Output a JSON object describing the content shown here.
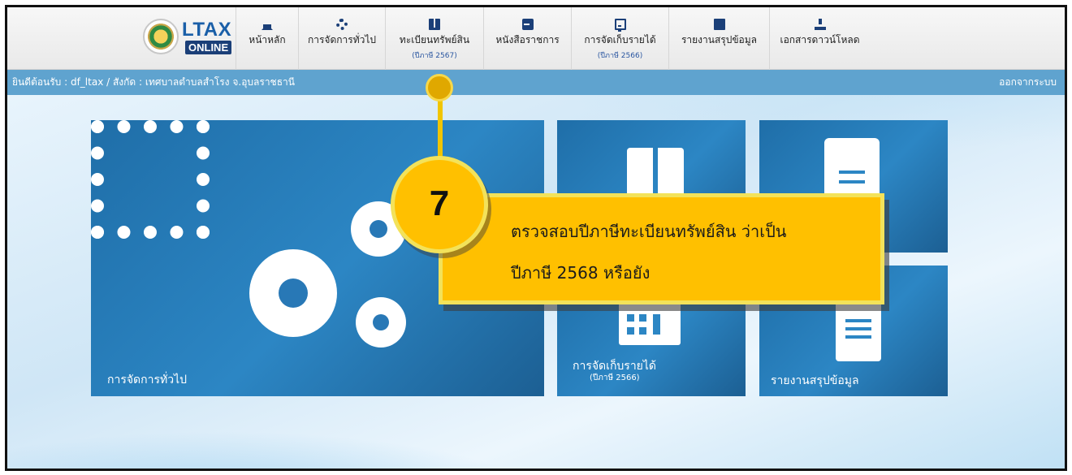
{
  "brand": {
    "title": "LTAX",
    "subtitle": "ONLINE"
  },
  "nav": [
    {
      "label": "หน้าหลัก",
      "icon": "home-icon",
      "sub": ""
    },
    {
      "label": "การจัดการทั่วไป",
      "icon": "gears-icon",
      "sub": ""
    },
    {
      "label": "ทะเบียนทรัพย์สิน",
      "icon": "book-icon",
      "sub": "(ปีภาษี 2567)"
    },
    {
      "label": "หนังสือราชการ",
      "icon": "document-icon",
      "sub": ""
    },
    {
      "label": "การจัดเก็บรายได้",
      "icon": "calculator-icon",
      "sub": "(ปีภาษี 2566)"
    },
    {
      "label": "รายงานสรุปข้อมูล",
      "icon": "report-icon",
      "sub": ""
    },
    {
      "label": "เอกสารดาวน์โหลด",
      "icon": "download-icon",
      "sub": ""
    }
  ],
  "welcome": {
    "text": "ยินดีต้อนรับ : df_ltax / สังกัด : เทศบาลตำบลสำโรง จ.อุบลราชธานี",
    "logout": "ออกจากระบบ"
  },
  "tiles": {
    "general": {
      "label": "การจัดการทั่วไป"
    },
    "revenue": {
      "label": "การจัดเก็บรายได้",
      "sub": "(ปีภาษี 2566)"
    },
    "summary": {
      "label": "รายงานสรุปข้อมูล"
    }
  },
  "annotation": {
    "step": "7",
    "line1": "ตรวจสอบปีภาษีทะเบียนทรัพย์สิน ว่าเป็น",
    "line2": "ปีภาษี 2568 หรือยัง"
  },
  "colors": {
    "accent": "#1b3f78",
    "bar": "#5fa3cf",
    "tile": "#2c86c4",
    "callout": "#ffc000"
  }
}
